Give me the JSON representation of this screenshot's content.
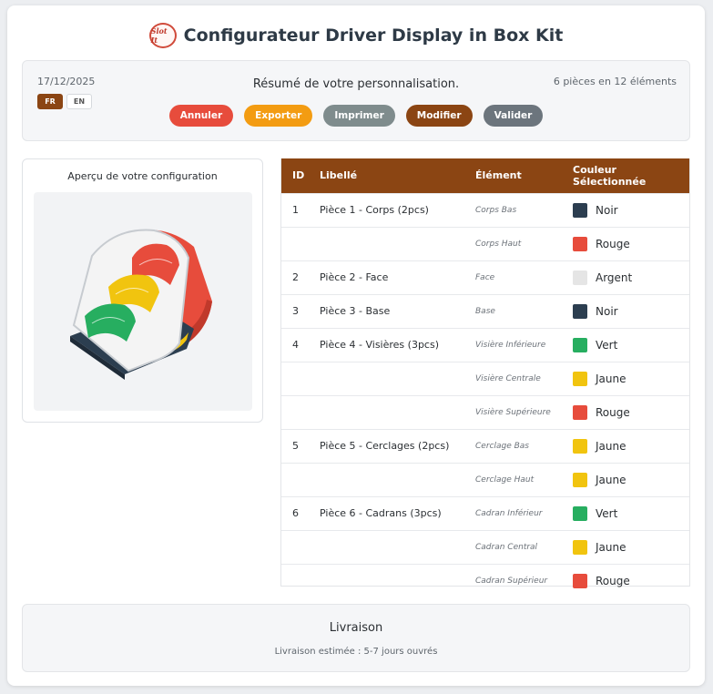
{
  "header": {
    "logo_text": "Slot It",
    "title": "Configurateur Driver Display in Box Kit"
  },
  "summary": {
    "date": "17/12/2025",
    "languages": [
      {
        "code": "FR",
        "active": true
      },
      {
        "code": "EN",
        "active": false
      }
    ],
    "title": "Résumé de votre personnalisation.",
    "pieces_count": "6 pièces en 12 éléments",
    "buttons": {
      "cancel": {
        "label": "Annuler",
        "color": "#e74c3c"
      },
      "export": {
        "label": "Exporter",
        "color": "#f39c12"
      },
      "print": {
        "label": "Imprimer",
        "color": "#7f8c8d"
      },
      "modify": {
        "label": "Modifier",
        "color": "#8b4513"
      },
      "validate": {
        "label": "Valider",
        "color": "#6c757d"
      }
    }
  },
  "preview": {
    "title": "Aperçu de votre configuration"
  },
  "table": {
    "headers": {
      "id": "ID",
      "label": "Libellé",
      "element": "Élément",
      "color": "Couleur Sélectionnée"
    },
    "header_color": "#8b4513",
    "rows": [
      {
        "id": "1",
        "label": "Pièce 1 - Corps (2pcs)",
        "element": "Corps Bas",
        "color_name": "Noir",
        "color_hex": "#2c3e50"
      },
      {
        "id": "",
        "label": "",
        "element": "Corps Haut",
        "color_name": "Rouge",
        "color_hex": "#e74c3c"
      },
      {
        "id": "2",
        "label": "Pièce 2 - Face",
        "element": "Face",
        "color_name": "Argent",
        "color_hex": "#e5e5e5"
      },
      {
        "id": "3",
        "label": "Pièce 3 - Base",
        "element": "Base",
        "color_name": "Noir",
        "color_hex": "#2c3e50"
      },
      {
        "id": "4",
        "label": "Pièce 4 - Visières (3pcs)",
        "element": "Visière Inférieure",
        "color_name": "Vert",
        "color_hex": "#27ae60"
      },
      {
        "id": "",
        "label": "",
        "element": "Visière Centrale",
        "color_name": "Jaune",
        "color_hex": "#f1c40f"
      },
      {
        "id": "",
        "label": "",
        "element": "Visière Supérieure",
        "color_name": "Rouge",
        "color_hex": "#e74c3c"
      },
      {
        "id": "5",
        "label": "Pièce 5 - Cerclages (2pcs)",
        "element": "Cerclage Bas",
        "color_name": "Jaune",
        "color_hex": "#f1c40f"
      },
      {
        "id": "",
        "label": "",
        "element": "Cerclage Haut",
        "color_name": "Jaune",
        "color_hex": "#f1c40f"
      },
      {
        "id": "6",
        "label": "Pièce 6 - Cadrans (3pcs)",
        "element": "Cadran Inférieur",
        "color_name": "Vert",
        "color_hex": "#27ae60"
      },
      {
        "id": "",
        "label": "",
        "element": "Cadran Central",
        "color_name": "Jaune",
        "color_hex": "#f1c40f"
      },
      {
        "id": "",
        "label": "",
        "element": "Cadran Supérieur",
        "color_name": "Rouge",
        "color_hex": "#e74c3c"
      }
    ]
  },
  "delivery": {
    "title": "Livraison",
    "text": "Livraison estimée : 5-7 jours ouvrés"
  }
}
